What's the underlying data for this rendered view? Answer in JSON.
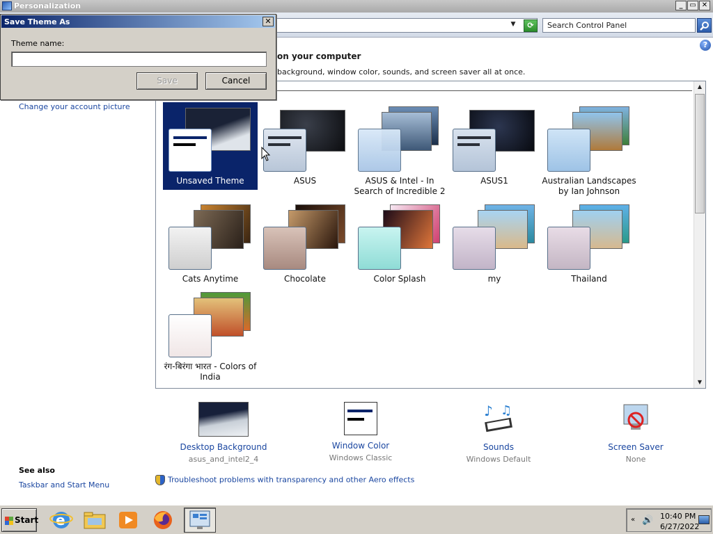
{
  "window": {
    "title": "Personalization",
    "minimize_icon": "_",
    "restore_icon": "▭",
    "close_icon": "✕"
  },
  "address_bar": {
    "dropdown_icon": "▼",
    "search_placeholder": "Search Control Panel"
  },
  "content": {
    "heading": "on your computer",
    "subheading": "background, window color, sounds, and screen saver all at once.",
    "help_icon": "?"
  },
  "left_panel": {
    "change_picture": "Change your account picture",
    "see_also": "See also",
    "taskbar_link": "Taskbar and Start Menu"
  },
  "themes": [
    {
      "label": "Unsaved Theme",
      "selected": true
    },
    {
      "label": "ASUS",
      "selected": false
    },
    {
      "label": "ASUS & Intel - In Search of Incredible 2",
      "selected": false
    },
    {
      "label": "ASUS1",
      "selected": false
    },
    {
      "label": "Australian Landscapes by Ian Johnson",
      "selected": false
    },
    {
      "label": "Cats Anytime",
      "selected": false
    },
    {
      "label": "Chocolate",
      "selected": false
    },
    {
      "label": "Color Splash",
      "selected": false
    },
    {
      "label": "my",
      "selected": false
    },
    {
      "label": "Thailand",
      "selected": false
    },
    {
      "label": "रंग-बिरंगा भारत - Colors of India",
      "selected": false
    }
  ],
  "bottom": {
    "desktop_background": {
      "name": "Desktop Background",
      "value": "asus_and_intel2_4"
    },
    "window_color": {
      "name": "Window Color",
      "value": "Windows Classic"
    },
    "sounds": {
      "name": "Sounds",
      "value": "Windows Default"
    },
    "screen_saver": {
      "name": "Screen Saver",
      "value": "None"
    },
    "troubleshoot": "Troubleshoot problems with transparency and other Aero effects"
  },
  "dialog": {
    "title": "Save Theme As",
    "close_icon": "✕",
    "label": "Theme name:",
    "input_value": "",
    "save_label": "Save",
    "cancel_label": "Cancel"
  },
  "taskbar": {
    "start_label": "Start",
    "time": "10:40 PM",
    "date": "6/27/2022",
    "tray_chevron": "«",
    "volume_icon": "🔊"
  },
  "colors": {
    "selection": "#0a246a",
    "link": "#1a46a0",
    "dialog_face": "#d4d0c8"
  }
}
